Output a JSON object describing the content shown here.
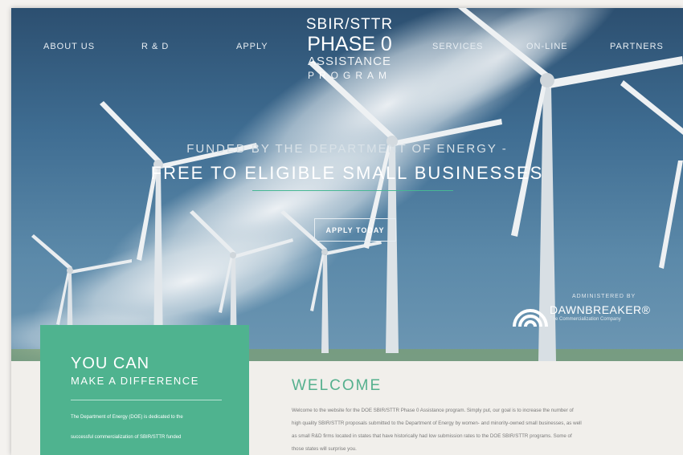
{
  "nav": {
    "left": [
      "ABOUT US",
      "R & D",
      "APPLY"
    ],
    "right": [
      "SERVICES",
      "ON-LINE",
      "PARTNERS"
    ]
  },
  "logo": {
    "line1": "SBIR/STTR",
    "line2": "PHASE 0",
    "line3": "ASSISTANCE",
    "line4": "PROGRAM"
  },
  "hero": {
    "funded": "FUNDED BY THE DEPARTMENT OF ENERGY -",
    "free": "FREE TO ELIGIBLE SMALL BUSINESSES",
    "cta": "APPLY TODAY",
    "administered": "ADMINISTERED BY",
    "brand_name": "DAWNBREAKER®",
    "brand_tagline": "The Commercialization Company"
  },
  "feature": {
    "title": "YOU CAN",
    "subtitle": "MAKE A DIFFERENCE",
    "p1": "The Department of Energy (DOE) is dedicated to the",
    "p2": "successful commercialization of SBIR/STTR funded"
  },
  "welcome": {
    "title": "WELCOME",
    "lines": [
      "Welcome to the website for the DOE SBIR/STTR Phase 0 Assistance program. Simply put, our goal is to increase the number of",
      "high quality SBIR/STTR proposals submitted to the Department of Energy by women- and minority-owned small businesses, as well",
      "as small R&D firms located in states that have historically had low submission rates to the DOE SBIR/STTR programs. Some of",
      "those states will surprise you."
    ]
  },
  "colors": {
    "accent": "#4fb38f",
    "sky": "#3f6d92",
    "page_bg": "#f1efeb"
  }
}
